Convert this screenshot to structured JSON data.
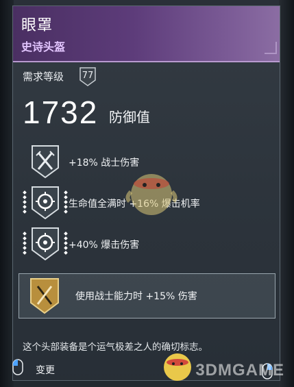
{
  "item": {
    "name": "眼罩",
    "rarity": "史诗头盔"
  },
  "requirement": {
    "label": "需求等级",
    "level": "77"
  },
  "armor": {
    "value": "1732",
    "label": "防御值"
  },
  "perks": [
    {
      "label": "+18% 战士伤害",
      "icon": "crossed-swords-icon"
    },
    {
      "label": "生命值全满时 +16% 爆击机率",
      "icon": "crosshair-icon"
    },
    {
      "label": "+40% 爆击伤害",
      "icon": "crosshair-icon"
    }
  ],
  "set_bonus": {
    "label": "使用战士能力时 +15% 伤害",
    "icon": "gold-swords-icon"
  },
  "flavor_text": "这个头部装备是个运气极差之人的确切标志。",
  "footer": {
    "action_label": "变更"
  },
  "watermark": "3DMGAME",
  "colors": {
    "epic_purple": "#5d3c7a",
    "rarity_text": "#e3c6ff",
    "gold": "#c9a24a"
  }
}
